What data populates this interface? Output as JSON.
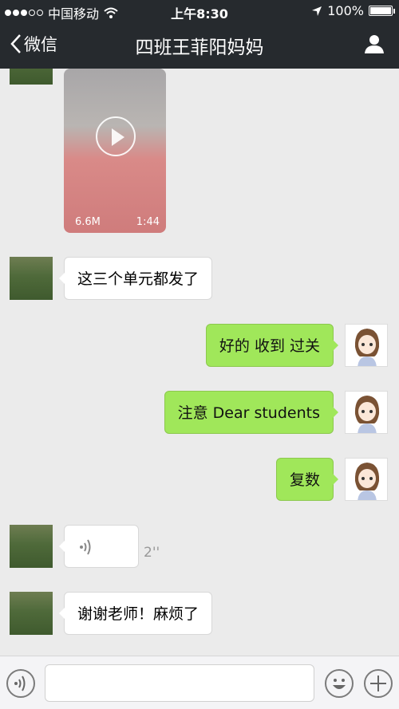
{
  "status_bar": {
    "carrier": "中国移动",
    "time": "上午8:30",
    "battery": "100%"
  },
  "nav": {
    "back_label": "微信",
    "title": "四班王菲阳妈妈"
  },
  "messages": [
    {
      "type": "video",
      "side": "left",
      "size": "6.6M",
      "duration": "1:44"
    },
    {
      "type": "text",
      "side": "left",
      "text": "这三个单元都发了"
    },
    {
      "type": "text",
      "side": "right",
      "text": "好的 收到 过关"
    },
    {
      "type": "text",
      "side": "right",
      "text": "注意 Dear students"
    },
    {
      "type": "text",
      "side": "right",
      "text": "复数"
    },
    {
      "type": "voice",
      "side": "left",
      "length": "2''"
    },
    {
      "type": "text",
      "side": "left",
      "text": "谢谢老师！麻烦了"
    }
  ],
  "input_bar": {
    "placeholder": ""
  },
  "colors": {
    "header_bg": "#262a2e",
    "chat_bg": "#ebebeb",
    "self_bubble": "#a0e75a"
  }
}
